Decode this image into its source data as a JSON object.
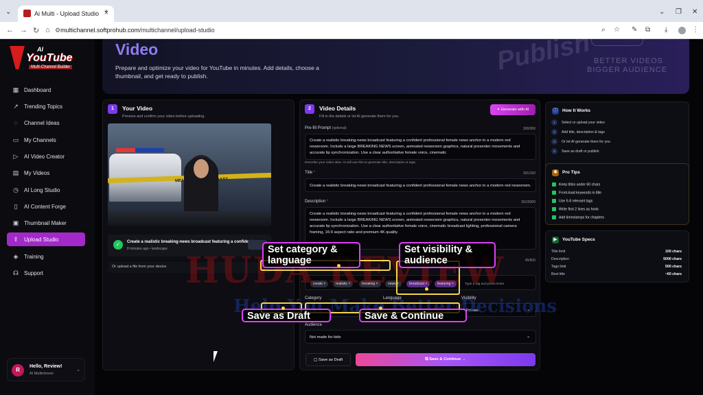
{
  "browser": {
    "tab_title": "Ai Multi - Upload Studio",
    "url_host": "multichannel.softprohub.com",
    "url_path": "/multichannel/upload-studio"
  },
  "logo": {
    "ai": "AI",
    "name": "YouTube",
    "sub": "Multi-Channel Builder"
  },
  "sidebar": {
    "items": [
      {
        "label": "Dashboard",
        "icon": "grid-icon"
      },
      {
        "label": "Trending Topics",
        "icon": "trend-icon"
      },
      {
        "label": "Channel Ideas",
        "icon": "lightbulb-icon"
      },
      {
        "label": "My Channels",
        "icon": "folder-icon"
      },
      {
        "label": "AI Video Creator",
        "icon": "video-icon"
      },
      {
        "label": "My Videos",
        "icon": "film-icon"
      },
      {
        "label": "AI Long Studio",
        "icon": "clock-icon"
      },
      {
        "label": "AI Content Forge",
        "icon": "document-icon"
      },
      {
        "label": "Thumbnail Maker",
        "icon": "image-icon"
      },
      {
        "label": "Upload Studio",
        "icon": "upload-icon",
        "active": true
      },
      {
        "label": "Training",
        "icon": "graduation-icon"
      },
      {
        "label": "Support",
        "icon": "headset-icon"
      }
    ],
    "user": {
      "initial": "R",
      "name": "Hello, Review!",
      "sub": "AI Multichnnel"
    }
  },
  "hero": {
    "title": "Video",
    "desc": "Prepare and optimize your video for YouTube in minutes. Add details, choose a thumbnail, and get ready to publish.",
    "deco_script": "Publish",
    "deco_line1": "BETTER VIDEOS",
    "deco_line2": "BIGGER AUDIENCE"
  },
  "your_video": {
    "step": "1",
    "title": "Your Video",
    "subtitle": "Preview and confirm your video before uploading.",
    "tape_text": "MEAAORE! CKAVNE AASY",
    "file_title": "Create a realistic breaking-news broadcast featuring a confident pr...",
    "file_meta": "8 minutes ago • landscape",
    "upload_text": "Or upload a file from your device"
  },
  "details": {
    "step": "2",
    "title": "Video Details",
    "subtitle": "Fill in the details or let AI generate them for you.",
    "generate_label": "Generate with AI",
    "prefill": {
      "label": "Pre-fill Prompt",
      "optional": "(optional)",
      "count": "300/300",
      "value": "Create a realistic breaking-news broadcast featuring a confident professional female news anchor in a modern red newsroom. Include a large BREAKING NEWS screen, animated newsroom graphics, natural presenter movements and accurate lip synchronization. Use a clear authoritative female voice, cinematic",
      "hint": "Describe your video idea. AI will use this to generate title, description & tags."
    },
    "title_field": {
      "label": "Title",
      "count": "391/100",
      "value": "Create a realistic breaking-news broadcast featuring a confident professional female news anchor in a modern red newsroom."
    },
    "description_field": {
      "label": "Description",
      "count": "391/5000",
      "value": "Create a realistic breaking-news broadcast featuring a confident professional female news anchor in a modern red newsroom. Include a large BREAKING NEWS screen, animated newsroom graphics, natural presenter movements and accurate lip synchronization. Use a clear authoritative female voice, cinematic broadcast lighting, professional camera framing, 16:9 aspect ratio and premium 4K quality."
    },
    "tags": {
      "count": "45/500",
      "chips": [
        "create ×",
        "realistic ×",
        "breaking ×",
        "news ×",
        "broadcast ×",
        "featuring ×"
      ],
      "placeholder": "Type a tag and press Enter"
    },
    "category": {
      "label": "Category",
      "value": "...ts"
    },
    "language": {
      "label": "Language",
      "value": ""
    },
    "visibility": {
      "label": "Visibility",
      "value": "Private"
    },
    "audience": {
      "label": "Audience",
      "value": "Not made for kids"
    },
    "draft_label": "Save as Draft",
    "continue_label": "Save & Continue"
  },
  "how_it_works": {
    "title": "How It Works",
    "steps": [
      {
        "n": "1",
        "text": "Select or upload your video"
      },
      {
        "n": "2",
        "text": "Add title, description & tags"
      },
      {
        "n": "3",
        "text": "Or let AI generate them for you"
      },
      {
        "n": "4",
        "text": "Save as draft or publish"
      }
    ]
  },
  "pro_tips": {
    "title": "Pro Tips",
    "tips": [
      "Keep titles under 60 chars",
      "Front-load keywords in title",
      "Use 5-8 relevant tags",
      "Write first 2 lines as hook",
      "Add timestamps for chapters"
    ]
  },
  "specs": {
    "title": "YouTube Specs",
    "rows": [
      {
        "k": "Title limit",
        "v": "100 chars"
      },
      {
        "k": "Description",
        "v": "5000 chars"
      },
      {
        "k": "Tags limit",
        "v": "500 chars"
      },
      {
        "k": "Best title",
        "v": "~60 chars"
      }
    ]
  },
  "overlay": {
    "callout_category": "Set category & language",
    "callout_visibility": "Set visibility & audience",
    "callout_draft": "Save as Draft",
    "callout_continue": "Save & Continue",
    "watermark_1": "HUDA REVIEW",
    "watermark_2": "Help You Make Better Decisions"
  },
  "colors": {
    "accent": "#a329c9",
    "brand_red": "#d81b1b",
    "callout_border": "#e040fb",
    "highlight": "#f5d74a"
  }
}
